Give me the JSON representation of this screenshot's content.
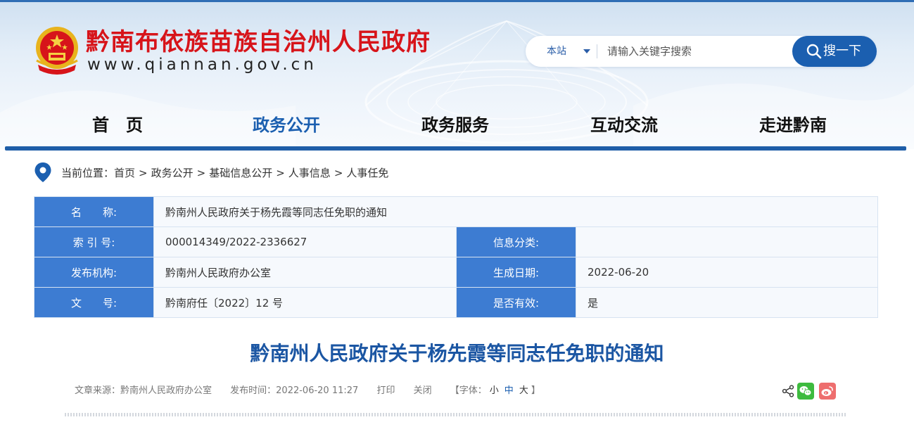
{
  "header": {
    "site_title": "黔南布依族苗族自治州人民政府",
    "site_url": "www.qiannan.gov.cn",
    "emblem_icon": "national-emblem-icon",
    "search": {
      "scope_label": "本站",
      "placeholder": "请输入关键字搜索",
      "button_label": "搜一下"
    },
    "nav": [
      {
        "label": "首　页",
        "active": false
      },
      {
        "label": "政务公开",
        "active": true
      },
      {
        "label": "政务服务",
        "active": false
      },
      {
        "label": "互动交流",
        "active": false
      },
      {
        "label": "走进黔南",
        "active": false
      }
    ]
  },
  "breadcrumb": {
    "prefix": "当前位置：",
    "items": [
      "首页",
      "政务公开",
      "基础信息公开",
      "人事信息",
      "人事任免"
    ],
    "separator": ">"
  },
  "info_table": {
    "name_label": "名　　称:",
    "name_value": "黔南州人民政府关于杨先霞等同志任免职的通知",
    "index_label": "索 引 号:",
    "index_value": "000014349/2022-2336627",
    "category_label": "信息分类:",
    "category_value": "",
    "publisher_label": "发布机构:",
    "publisher_value": "黔南州人民政府办公室",
    "date_label": "生成日期:",
    "date_value": "2022-06-20",
    "docno_label": "文　　号:",
    "docno_value": "黔南府任〔2022〕12 号",
    "valid_label": "是否有效:",
    "valid_value": "是"
  },
  "article": {
    "title": "黔南州人民政府关于杨先霞等同志任免职的通知",
    "source": "文章来源：黔南州人民政府办公室",
    "time": "发布时间：2022-06-20 11:27",
    "print_label": "打印",
    "close_label": "关闭",
    "font_prefix": "【字体：",
    "font_small": "小",
    "font_medium": "中",
    "font_large": "大",
    "font_suffix": "】"
  },
  "share": {
    "icons": [
      "share-icon",
      "wechat-icon",
      "weibo-icon"
    ]
  },
  "colors": {
    "brand_red": "#d7141a",
    "brand_blue": "#1b5fb0",
    "label_cell_blue": "#3d7cd2",
    "title_blue": "#1b56a3",
    "wechat_green": "#3dbb3e",
    "weibo_red": "#ee6e6e"
  }
}
